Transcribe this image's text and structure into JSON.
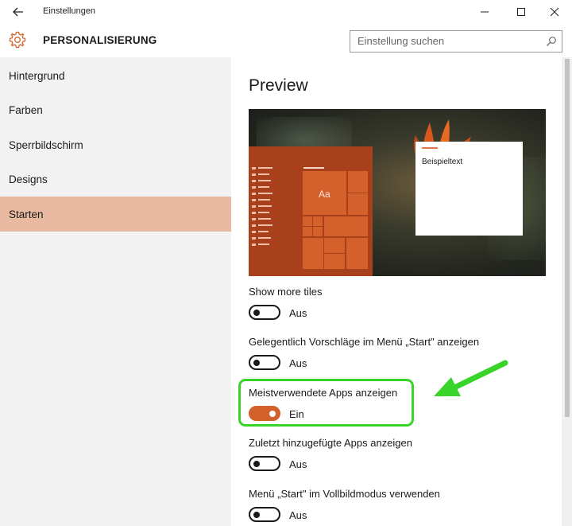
{
  "window": {
    "title": "Einstellungen"
  },
  "header": {
    "section_title": "PERSONALISIERUNG",
    "search_placeholder": "Einstellung suchen"
  },
  "sidebar": {
    "items": [
      {
        "label": "Hintergrund"
      },
      {
        "label": "Farben"
      },
      {
        "label": "Sperrbildschirm"
      },
      {
        "label": "Designs"
      },
      {
        "label": "Starten"
      }
    ],
    "active_item": "Starten"
  },
  "main": {
    "preview_title": "Preview",
    "preview": {
      "tile_text": "Aa",
      "sample_text": "Beispieltext"
    },
    "settings": [
      {
        "label": "Show more tiles",
        "state": "Aus",
        "on": false
      },
      {
        "label": "Gelegentlich Vorschläge im Menü „Start\" anzeigen",
        "state": "Aus",
        "on": false
      },
      {
        "label": "Meistverwendete Apps anzeigen",
        "state": "Ein",
        "on": true
      },
      {
        "label": "Zuletzt hinzugefügte Apps anzeigen",
        "state": "Aus",
        "on": false
      },
      {
        "label": "Menü „Start\" im Vollbildmodus verwenden",
        "state": "Aus",
        "on": false
      }
    ]
  },
  "colors": {
    "accent": "#d2612b",
    "active_nav": "#e9b9a1",
    "highlight": "#39d42a"
  },
  "icons": {
    "back": "back-arrow-icon",
    "settings": "gear-icon",
    "search": "search-icon",
    "minimize": "minimize-icon",
    "maximize": "maximize-icon",
    "close": "close-icon"
  }
}
